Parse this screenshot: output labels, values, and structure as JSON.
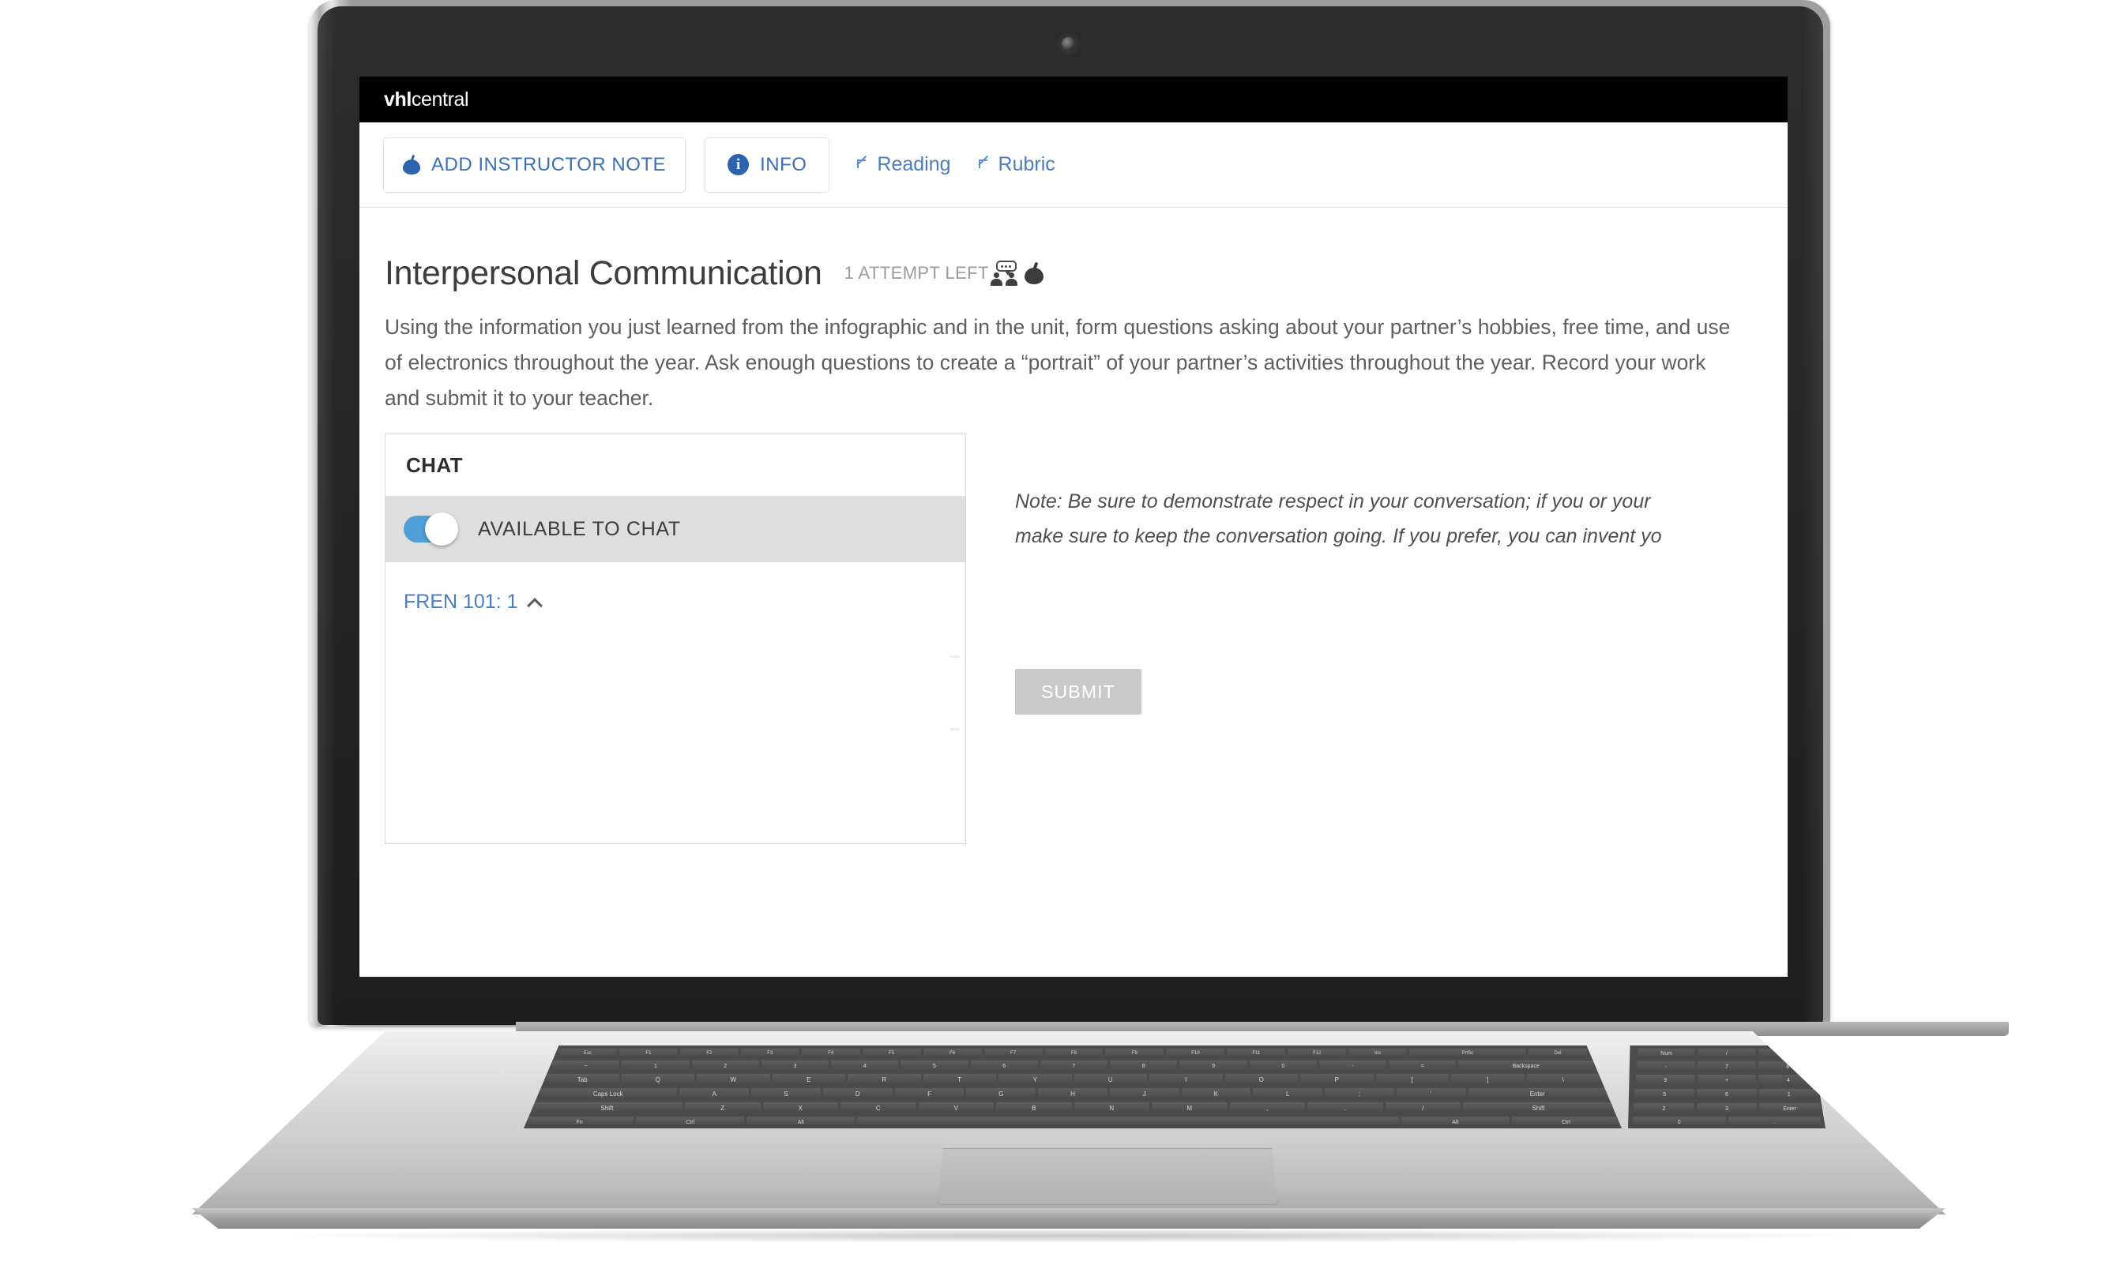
{
  "app": {
    "brand_bold": "vhl",
    "brand_light": "central"
  },
  "toolbar": {
    "add_note_label": "ADD INSTRUCTOR NOTE",
    "add_note_icon": "apple-icon",
    "info_label": "INFO",
    "info_icon": "info-circle-icon",
    "links": [
      {
        "label": "Reading",
        "icon": "arrow-up-left-icon"
      },
      {
        "label": "Rubric",
        "icon": "arrow-up-left-icon"
      }
    ]
  },
  "activity": {
    "title": "Interpersonal Communication",
    "attempts_label": "1 ATTEMPT LEFT",
    "partner_icon": "two-people-speech-bubble-icon",
    "teacher_icon": "apple-icon",
    "description": "Using the information you just learned from the infographic and in the unit, form questions asking about your partner’s hobbies, free time, and use of electronics throughout the year. Ask enough questions to create a “portrait” of your partner’s activities throughout the year. Record your work and submit it to your teacher."
  },
  "chat": {
    "header": "CHAT",
    "available_label": "AVAILABLE TO CHAT",
    "available_state": "on",
    "course_label": "FREN 101: 1",
    "course_chevron": "chevron-up-icon"
  },
  "note": {
    "line1": "Note: Be sure to demonstrate respect in your conversation; if you or your",
    "line2": "make sure to keep the conversation going. If you prefer, you can invent yo"
  },
  "actions": {
    "submit_label": "SUBMIT"
  },
  "colors": {
    "link_blue": "#4a7cc0",
    "brand_blue": "#2d63ad",
    "toggle_on": "#4e9fd8",
    "submit_disabled": "#c9c9c9",
    "appbar_black": "#000000",
    "row_highlight": "#dedede"
  },
  "keyboard": {
    "row_fn": [
      "Esc",
      "F1",
      "F2",
      "F3",
      "F4",
      "F5",
      "F6",
      "F7",
      "F8",
      "F9",
      "F10",
      "F11",
      "F12",
      "Ins",
      "PrtSc",
      "Del"
    ],
    "row_num": [
      "~",
      "1",
      "2",
      "3",
      "4",
      "5",
      "6",
      "7",
      "8",
      "9",
      "0",
      "-",
      "=",
      "Backspace"
    ],
    "row_q": [
      "Tab",
      "Q",
      "W",
      "E",
      "R",
      "T",
      "Y",
      "U",
      "I",
      "O",
      "P",
      "[",
      "]",
      "\\"
    ],
    "row_a": [
      "Caps Lock",
      "A",
      "S",
      "D",
      "F",
      "G",
      "H",
      "J",
      "K",
      "L",
      ";",
      "'",
      "Enter"
    ],
    "row_z": [
      "Shift",
      "Z",
      "X",
      "C",
      "V",
      "B",
      "N",
      "M",
      ",",
      ".",
      "/",
      "Shift"
    ],
    "row_space": [
      "Fn",
      "Ctrl",
      "Alt",
      "",
      "Alt",
      "Ctrl"
    ],
    "numpad": [
      "Num",
      "/",
      "*",
      "-",
      "7",
      "8",
      "9",
      "+",
      "4",
      "5",
      "6",
      "1",
      "2",
      "3",
      "Enter",
      "0",
      "."
    ]
  }
}
